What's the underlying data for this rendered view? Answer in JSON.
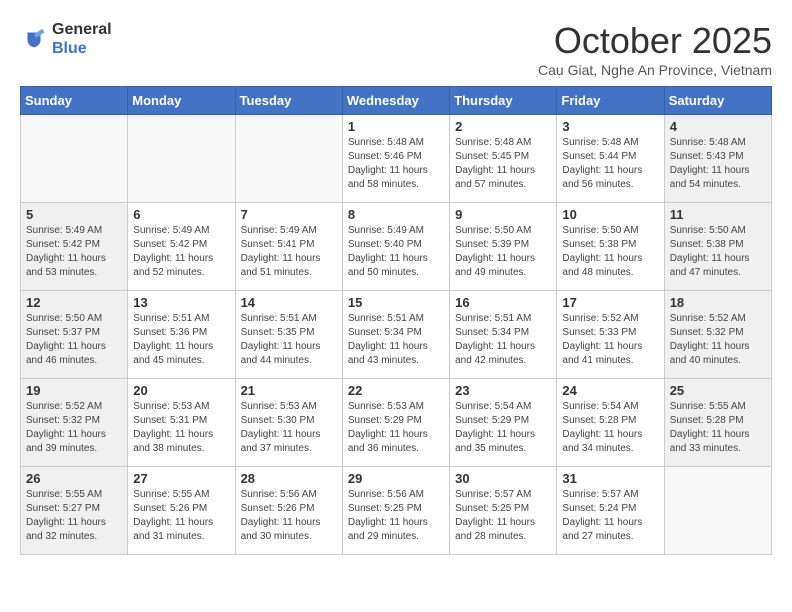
{
  "header": {
    "logo_general": "General",
    "logo_blue": "Blue",
    "title": "October 2025",
    "location": "Cau Giat, Nghe An Province, Vietnam"
  },
  "weekdays": [
    "Sunday",
    "Monday",
    "Tuesday",
    "Wednesday",
    "Thursday",
    "Friday",
    "Saturday"
  ],
  "weeks": [
    [
      {
        "day": "",
        "detail": ""
      },
      {
        "day": "",
        "detail": ""
      },
      {
        "day": "",
        "detail": ""
      },
      {
        "day": "1",
        "detail": "Sunrise: 5:48 AM\nSunset: 5:46 PM\nDaylight: 11 hours\nand 58 minutes."
      },
      {
        "day": "2",
        "detail": "Sunrise: 5:48 AM\nSunset: 5:45 PM\nDaylight: 11 hours\nand 57 minutes."
      },
      {
        "day": "3",
        "detail": "Sunrise: 5:48 AM\nSunset: 5:44 PM\nDaylight: 11 hours\nand 56 minutes."
      },
      {
        "day": "4",
        "detail": "Sunrise: 5:48 AM\nSunset: 5:43 PM\nDaylight: 11 hours\nand 54 minutes."
      }
    ],
    [
      {
        "day": "5",
        "detail": "Sunrise: 5:49 AM\nSunset: 5:42 PM\nDaylight: 11 hours\nand 53 minutes."
      },
      {
        "day": "6",
        "detail": "Sunrise: 5:49 AM\nSunset: 5:42 PM\nDaylight: 11 hours\nand 52 minutes."
      },
      {
        "day": "7",
        "detail": "Sunrise: 5:49 AM\nSunset: 5:41 PM\nDaylight: 11 hours\nand 51 minutes."
      },
      {
        "day": "8",
        "detail": "Sunrise: 5:49 AM\nSunset: 5:40 PM\nDaylight: 11 hours\nand 50 minutes."
      },
      {
        "day": "9",
        "detail": "Sunrise: 5:50 AM\nSunset: 5:39 PM\nDaylight: 11 hours\nand 49 minutes."
      },
      {
        "day": "10",
        "detail": "Sunrise: 5:50 AM\nSunset: 5:38 PM\nDaylight: 11 hours\nand 48 minutes."
      },
      {
        "day": "11",
        "detail": "Sunrise: 5:50 AM\nSunset: 5:38 PM\nDaylight: 11 hours\nand 47 minutes."
      }
    ],
    [
      {
        "day": "12",
        "detail": "Sunrise: 5:50 AM\nSunset: 5:37 PM\nDaylight: 11 hours\nand 46 minutes."
      },
      {
        "day": "13",
        "detail": "Sunrise: 5:51 AM\nSunset: 5:36 PM\nDaylight: 11 hours\nand 45 minutes."
      },
      {
        "day": "14",
        "detail": "Sunrise: 5:51 AM\nSunset: 5:35 PM\nDaylight: 11 hours\nand 44 minutes."
      },
      {
        "day": "15",
        "detail": "Sunrise: 5:51 AM\nSunset: 5:34 PM\nDaylight: 11 hours\nand 43 minutes."
      },
      {
        "day": "16",
        "detail": "Sunrise: 5:51 AM\nSunset: 5:34 PM\nDaylight: 11 hours\nand 42 minutes."
      },
      {
        "day": "17",
        "detail": "Sunrise: 5:52 AM\nSunset: 5:33 PM\nDaylight: 11 hours\nand 41 minutes."
      },
      {
        "day": "18",
        "detail": "Sunrise: 5:52 AM\nSunset: 5:32 PM\nDaylight: 11 hours\nand 40 minutes."
      }
    ],
    [
      {
        "day": "19",
        "detail": "Sunrise: 5:52 AM\nSunset: 5:32 PM\nDaylight: 11 hours\nand 39 minutes."
      },
      {
        "day": "20",
        "detail": "Sunrise: 5:53 AM\nSunset: 5:31 PM\nDaylight: 11 hours\nand 38 minutes."
      },
      {
        "day": "21",
        "detail": "Sunrise: 5:53 AM\nSunset: 5:30 PM\nDaylight: 11 hours\nand 37 minutes."
      },
      {
        "day": "22",
        "detail": "Sunrise: 5:53 AM\nSunset: 5:29 PM\nDaylight: 11 hours\nand 36 minutes."
      },
      {
        "day": "23",
        "detail": "Sunrise: 5:54 AM\nSunset: 5:29 PM\nDaylight: 11 hours\nand 35 minutes."
      },
      {
        "day": "24",
        "detail": "Sunrise: 5:54 AM\nSunset: 5:28 PM\nDaylight: 11 hours\nand 34 minutes."
      },
      {
        "day": "25",
        "detail": "Sunrise: 5:55 AM\nSunset: 5:28 PM\nDaylight: 11 hours\nand 33 minutes."
      }
    ],
    [
      {
        "day": "26",
        "detail": "Sunrise: 5:55 AM\nSunset: 5:27 PM\nDaylight: 11 hours\nand 32 minutes."
      },
      {
        "day": "27",
        "detail": "Sunrise: 5:55 AM\nSunset: 5:26 PM\nDaylight: 11 hours\nand 31 minutes."
      },
      {
        "day": "28",
        "detail": "Sunrise: 5:56 AM\nSunset: 5:26 PM\nDaylight: 11 hours\nand 30 minutes."
      },
      {
        "day": "29",
        "detail": "Sunrise: 5:56 AM\nSunset: 5:25 PM\nDaylight: 11 hours\nand 29 minutes."
      },
      {
        "day": "30",
        "detail": "Sunrise: 5:57 AM\nSunset: 5:25 PM\nDaylight: 11 hours\nand 28 minutes."
      },
      {
        "day": "31",
        "detail": "Sunrise: 5:57 AM\nSunset: 5:24 PM\nDaylight: 11 hours\nand 27 minutes."
      },
      {
        "day": "",
        "detail": ""
      }
    ]
  ]
}
